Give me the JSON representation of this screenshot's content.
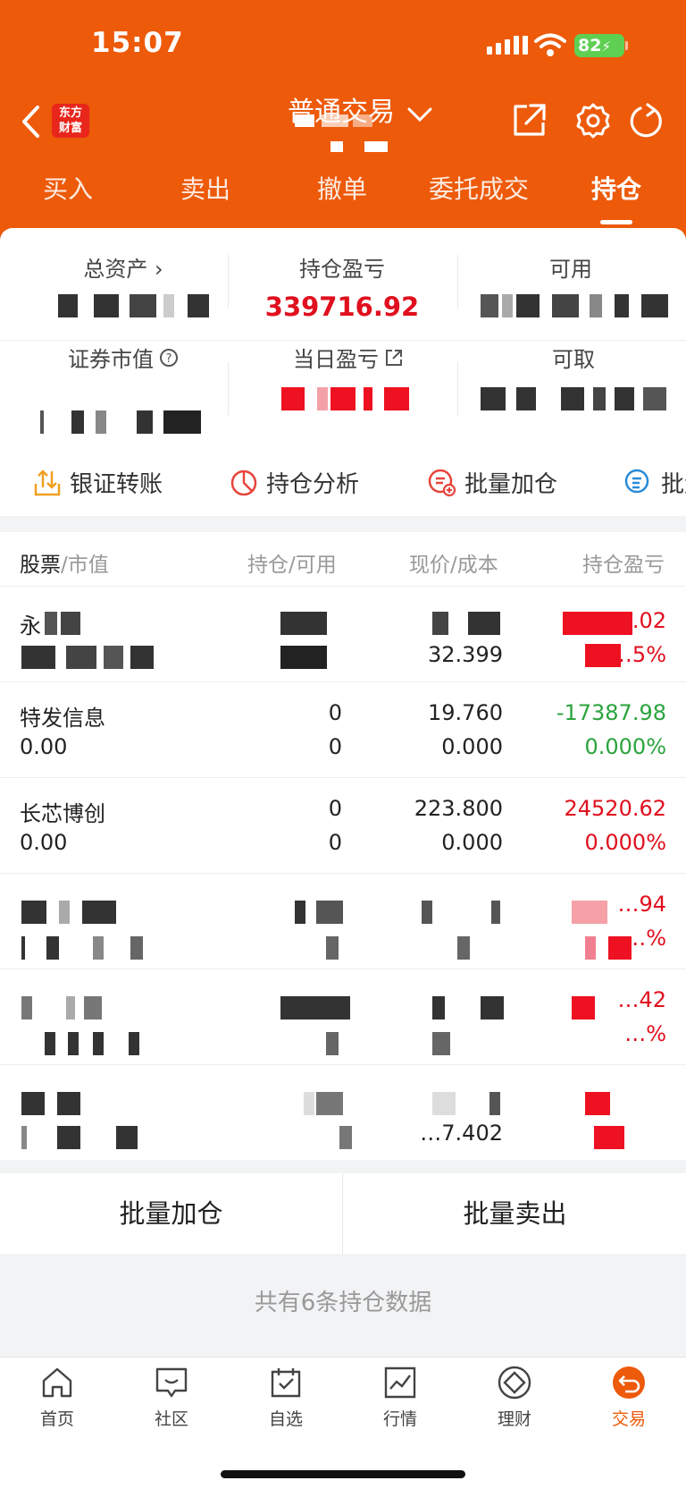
{
  "status_bar": {
    "time": "15:07",
    "battery": "82"
  },
  "header": {
    "logo_text": "东方\n财富",
    "title": "普通交易",
    "tabs": [
      {
        "label": "买入"
      },
      {
        "label": "卖出"
      },
      {
        "label": "撤单"
      },
      {
        "label": "委托成交"
      },
      {
        "label": "持仓"
      }
    ],
    "active_tab": "持仓"
  },
  "summary": {
    "total_assets_label": "总资产 ›",
    "position_pl_label": "持仓盈亏",
    "position_pl_value": "339716.92",
    "available_label": "可用",
    "market_value_label": "证券市值",
    "daily_pl_label": "当日盈亏",
    "withdrawable_label": "可取"
  },
  "shortcuts": [
    {
      "label": "银证转账",
      "icon": "transfer-icon"
    },
    {
      "label": "持仓分析",
      "icon": "pie-chart-icon"
    },
    {
      "label": "批量加仓",
      "icon": "batch-add-icon"
    },
    {
      "label": "批量",
      "icon": "batch-icon"
    }
  ],
  "table": {
    "headers": {
      "stock": "股票",
      "market_value": "/市值",
      "position": "持仓/可用",
      "price": "现价/成本",
      "pl": "持仓盈亏"
    },
    "rows": [
      {
        "name": "永",
        "market_value": "",
        "position": "",
        "available": "",
        "price": "",
        "cost": "32.399",
        "pl": "…58.02",
        "pl_pct": "…5%"
      },
      {
        "name": "特发信息",
        "market_value": "0.00",
        "position": "0",
        "available": "0",
        "price": "19.760",
        "cost": "0.000",
        "pl": "-17387.98",
        "pl_pct": "0.000%"
      },
      {
        "name": "长芯博创",
        "market_value": "0.00",
        "position": "0",
        "available": "0",
        "price": "223.800",
        "cost": "0.000",
        "pl": "24520.62",
        "pl_pct": "0.000%"
      },
      {
        "name": "",
        "market_value": "",
        "position": "",
        "available": "",
        "price": "",
        "cost": "",
        "pl": "…94",
        "pl_pct": "…%"
      },
      {
        "name": "",
        "market_value": "",
        "position": "",
        "available": "",
        "price": "",
        "cost": "",
        "pl": "…42",
        "pl_pct": "…%"
      },
      {
        "name": "",
        "market_value": "",
        "position": "",
        "available": "",
        "price": "",
        "cost": "…7.402",
        "pl": "",
        "pl_pct": ""
      }
    ]
  },
  "buttons": {
    "batch_add": "批量加仓",
    "batch_sell": "批量卖出"
  },
  "summary_text": "共有6条持仓数据",
  "tabbar": [
    {
      "label": "首页",
      "icon": "home-icon"
    },
    {
      "label": "社区",
      "icon": "chat-icon"
    },
    {
      "label": "自选",
      "icon": "watchlist-icon"
    },
    {
      "label": "行情",
      "icon": "chart-icon"
    },
    {
      "label": "理财",
      "icon": "diamond-icon"
    },
    {
      "label": "交易",
      "icon": "trade-icon"
    }
  ],
  "colors": {
    "brand": "#ed5a0a",
    "up": "#e0101e",
    "down": "#2ba33e"
  }
}
